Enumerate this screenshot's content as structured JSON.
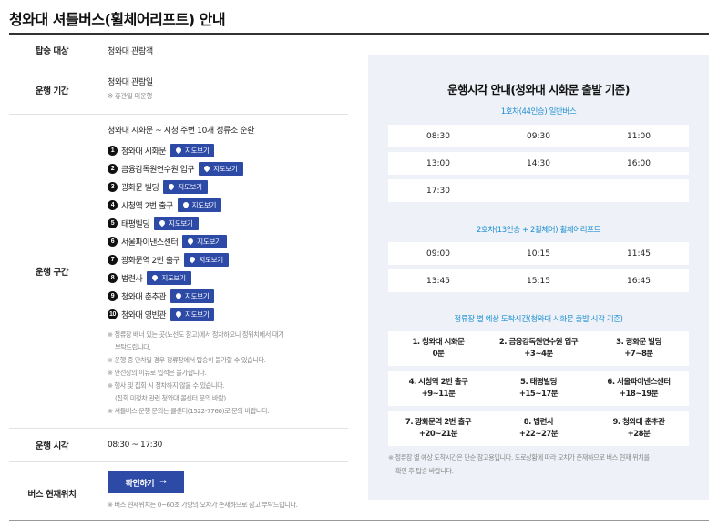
{
  "page": {
    "title": "청와대 셔틀버스(휠체어리프트) 안내"
  },
  "info": {
    "target": {
      "label": "탑승 대상",
      "value": "청와대 관람객"
    },
    "period": {
      "label": "운행 기간",
      "value": "청와대 관람일",
      "note": "※ 휴관일 미운행"
    },
    "route": {
      "label": "운행 구간",
      "head": "청와대 시화문 ~ 시청 주변 10개 정류소 순환",
      "map_button_label": "지도보기",
      "stops": [
        {
          "num": "1",
          "name": "청와대 시화문"
        },
        {
          "num": "2",
          "name": "금융감독원연수원 입구"
        },
        {
          "num": "3",
          "name": "광화문 빌딩"
        },
        {
          "num": "4",
          "name": "시청역 2번 출구"
        },
        {
          "num": "5",
          "name": "태평빌딩"
        },
        {
          "num": "6",
          "name": "서울파이낸스센터"
        },
        {
          "num": "7",
          "name": "광화문역 2번 출구"
        },
        {
          "num": "8",
          "name": "법련사"
        },
        {
          "num": "9",
          "name": "청와대 춘추관"
        },
        {
          "num": "10",
          "name": "청와대 영빈관"
        }
      ],
      "notes": [
        "※ 정류장 배너 있는 곳(노선도 참고)에서 정차하오니 정위치에서 대기",
        "부탁드립니다.",
        "※ 운행 중 만차일 경우 정류장에서 탑승이 불가할 수 있습니다.",
        "※ 안전상의 이유로 입석은 불가합니다.",
        "※ 행사 및 집회 시 정차하지 않을 수 있습니다.",
        "(집회 미정차 관련 청와대 콜센터 문의 바람)",
        "※ 셔틀버스 운행 문의는 콜센터(1522-7760)로 문의 바랍니다."
      ]
    },
    "time": {
      "label": "운행 시각",
      "value": "08:30 ~ 17:30"
    },
    "location": {
      "label": "버스 현재위치",
      "button_label": "확인하기",
      "button_arrow": "→",
      "note": "※ 버스 현재위치는 0~60초 가량의 오차가 존재하므로 참고 부탁드립니다."
    }
  },
  "schedule": {
    "title": "운행시각 안내(청와대 시화문 출발 기준)",
    "bus1": {
      "title": "1호차(44인승) 일반버스",
      "rows": [
        [
          "08:30",
          "09:30",
          "11:00"
        ],
        [
          "13:00",
          "14:30",
          "16:00"
        ],
        [
          "17:30",
          "",
          ""
        ]
      ]
    },
    "bus2": {
      "title": "2호차(13인승 + 2휠체어) 휠체어리프트",
      "rows": [
        [
          "09:00",
          "10:15",
          "11:45"
        ],
        [
          "13:45",
          "15:15",
          "16:45"
        ]
      ]
    },
    "arrival": {
      "title": "정류장 별 예상 도착시간(청와대 시화문 출발 시각 기준)",
      "rows": [
        [
          {
            "stop": "1. 청와대 시화문",
            "time": "0분"
          },
          {
            "stop": "2. 금융감독원연수원 입구",
            "time": "+3~4분"
          },
          {
            "stop": "3. 광화문 빌딩",
            "time": "+7~8분"
          }
        ],
        [
          {
            "stop": "4. 시청역 2번 출구",
            "time": "+9~11분"
          },
          {
            "stop": "5. 태평빌딩",
            "time": "+15~17분"
          },
          {
            "stop": "6. 서울파이낸스센터",
            "time": "+18~19분"
          }
        ],
        [
          {
            "stop": "7. 광화문역 2번 출구",
            "time": "+20~21분"
          },
          {
            "stop": "8. 법련사",
            "time": "+22~27분"
          },
          {
            "stop": "9. 청와대 춘추관",
            "time": "+28분"
          }
        ]
      ]
    },
    "note_line1": "※ 정류장 별 예상 도착시간은 단순 참고용입니다. 도로상황에 따라 오차가 존재하므로 버스 현재 위치를",
    "note_line2": "확인 후 탑승 바랍니다."
  }
}
